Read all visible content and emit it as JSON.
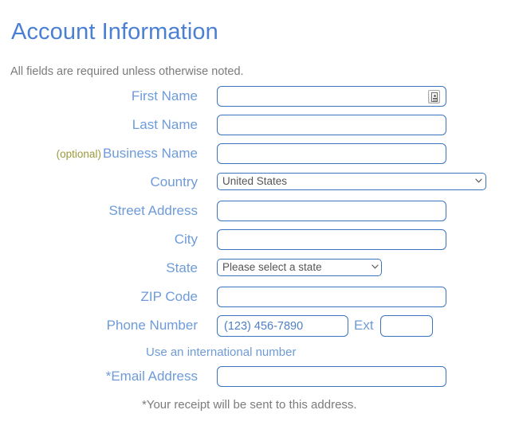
{
  "header": {
    "title": "Account Information",
    "subtitle": "All fields are required unless otherwise noted."
  },
  "form": {
    "rows": {
      "first_name": {
        "label": "First Name",
        "value": "",
        "placeholder": "",
        "autofill_icon": "contact-card-icon"
      },
      "last_name": {
        "label": "Last Name",
        "value": "",
        "placeholder": ""
      },
      "business_name": {
        "optional_tag": "(optional)",
        "label": "Business Name",
        "value": "",
        "placeholder": ""
      },
      "country": {
        "label": "Country",
        "selected": "United States"
      },
      "street_address": {
        "label": "Street Address",
        "value": "",
        "placeholder": ""
      },
      "city": {
        "label": "City",
        "value": "",
        "placeholder": ""
      },
      "state": {
        "label": "State",
        "selected": "Please select a state"
      },
      "zip_code": {
        "label": "ZIP Code",
        "value": "",
        "placeholder": ""
      },
      "phone_number": {
        "label": "Phone Number",
        "value": "",
        "placeholder": "(123) 456-7890",
        "ext_label": "Ext",
        "ext_value": "",
        "ext_placeholder": ""
      },
      "international_link": "Use an international number",
      "email_address": {
        "label": "*Email Address",
        "value": "",
        "placeholder": ""
      },
      "receipt_note": "*Your receipt will be sent to this address."
    }
  },
  "colors": {
    "title_blue": "#4a7fd4",
    "label_blue": "#6e9bd9",
    "border_blue": "#3b74bd",
    "optional_olive": "#9a9a3c",
    "muted_gray": "#7b7b7b",
    "page_background": "#ffffff"
  }
}
